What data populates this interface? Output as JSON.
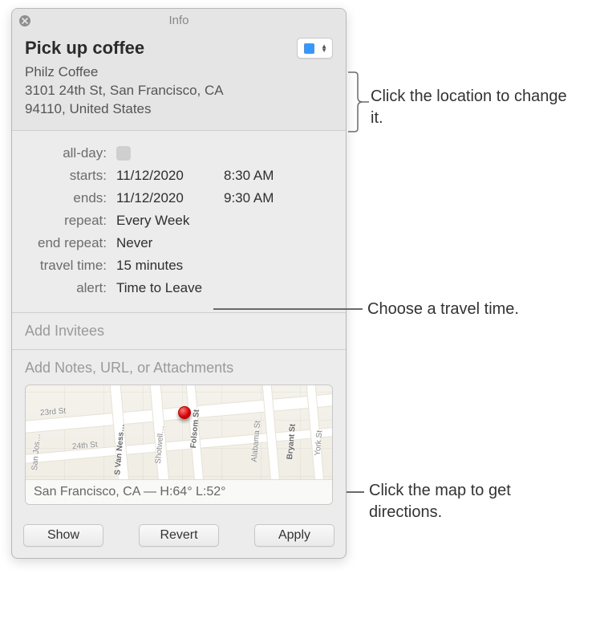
{
  "window": {
    "title": "Info"
  },
  "event": {
    "title": "Pick up coffee",
    "location_name": "Philz Coffee",
    "location_addr1": "3101 24th St, San Francisco, CA",
    "location_addr2": "94110, United States"
  },
  "details": {
    "all_day_label": "all-day:",
    "starts_label": "starts:",
    "starts_date": "11/12/2020",
    "starts_time": "8:30 AM",
    "ends_label": "ends:",
    "ends_date": "11/12/2020",
    "ends_time": "9:30 AM",
    "repeat_label": "repeat:",
    "repeat_value": "Every Week",
    "end_repeat_label": "end repeat:",
    "end_repeat_value": "Never",
    "travel_time_label": "travel time:",
    "travel_time_value": "15 minutes",
    "alert_label": "alert:",
    "alert_value": "Time to Leave"
  },
  "invitees_placeholder": "Add Invitees",
  "notes_placeholder": "Add Notes, URL, or Attachments",
  "map": {
    "weather_line": "San Francisco, CA — H:64° L:52°",
    "streets": {
      "s23rd": "23rd St",
      "s24th": "24th St",
      "svanness": "S Van Ness…",
      "shotwell": "Shotwell…",
      "folsom": "Folsom St",
      "alabama": "Alabama St",
      "bryant": "Bryant St",
      "york": "York St",
      "sanjose": "San Jos…"
    }
  },
  "buttons": {
    "show": "Show",
    "revert": "Revert",
    "apply": "Apply"
  },
  "callouts": {
    "location": "Click the location to change it.",
    "travel": "Choose a travel time.",
    "map": "Click the map to get directions."
  }
}
